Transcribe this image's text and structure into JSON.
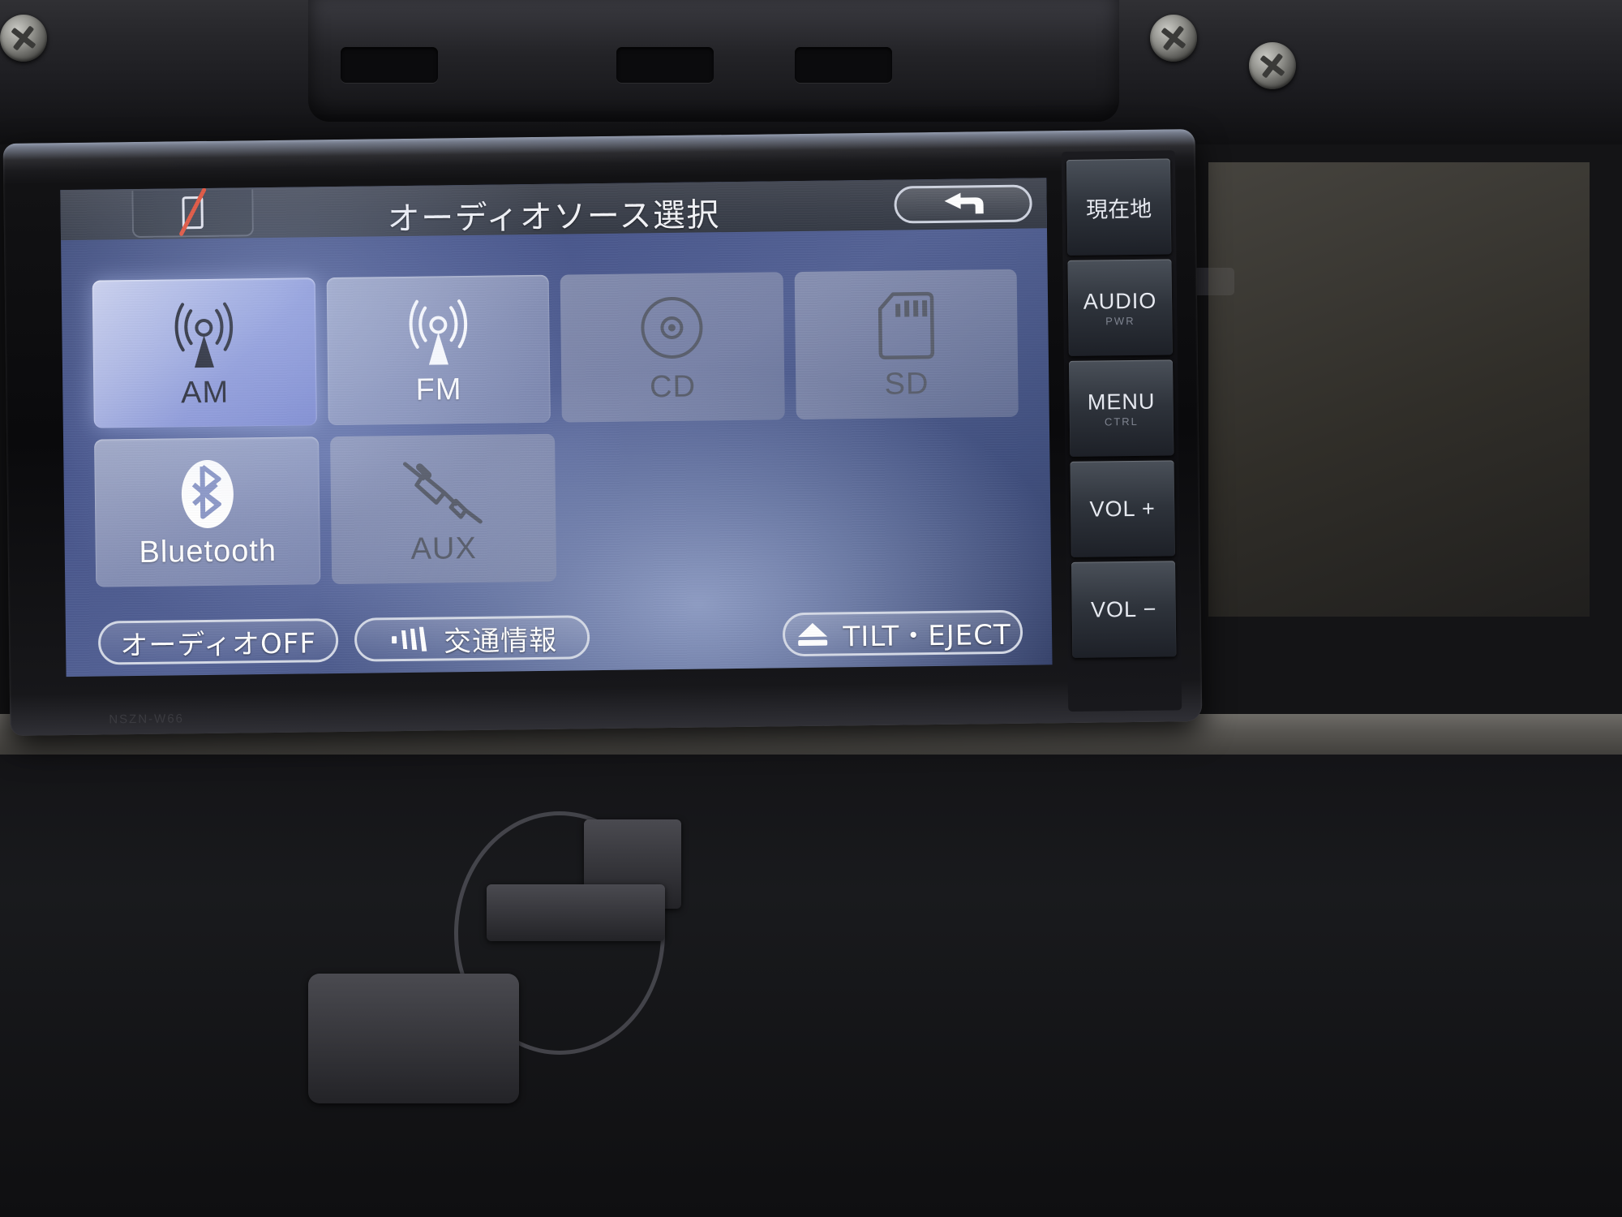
{
  "screen": {
    "title": "オーディオソース選択",
    "status_icon": "phone-disabled-icon",
    "back_button": {
      "name": "back-arrow-icon",
      "label": "↰"
    }
  },
  "sources": {
    "rows": [
      [
        {
          "id": "am",
          "label": "AM",
          "icon": "radio-antenna-icon",
          "state": "active"
        },
        {
          "id": "fm",
          "label": "FM",
          "icon": "radio-antenna-icon",
          "state": "normal"
        },
        {
          "id": "cd",
          "label": "CD",
          "icon": "compact-disc-icon",
          "state": "disabled"
        },
        {
          "id": "sd",
          "label": "SD",
          "icon": "sd-card-icon",
          "state": "disabled"
        }
      ],
      [
        {
          "id": "bluetooth",
          "label": "Bluetooth",
          "icon": "bluetooth-icon",
          "state": "normal"
        },
        {
          "id": "aux",
          "label": "AUX",
          "icon": "aux-plug-icon",
          "state": "disabled"
        }
      ]
    ]
  },
  "bottom_bar": {
    "audio_off": {
      "label": "オーディオOFF"
    },
    "traffic": {
      "label": "交通情報",
      "icon": "signal-waves-icon"
    },
    "tilt_eject": {
      "label": "TILT・EJECT",
      "icon": "eject-icon"
    }
  },
  "hardware_buttons": [
    {
      "id": "current-location",
      "main": "現在地",
      "sub": "",
      "type": "jp"
    },
    {
      "id": "audio",
      "main": "AUDIO",
      "sub": "PWR",
      "type": "en"
    },
    {
      "id": "menu",
      "main": "MENU",
      "sub": "CTRL",
      "type": "en"
    },
    {
      "id": "volume-up",
      "main": "VOL +",
      "sub": "",
      "type": "en"
    },
    {
      "id": "volume-down",
      "main": "VOL −",
      "sub": "",
      "type": "en"
    }
  ],
  "unit": {
    "model_text": "NSZN-W66"
  },
  "colors": {
    "screen_blue": "#4a5889",
    "tile_active": "#b0b9e4",
    "accent_red": "#e8492b",
    "text_white": "#f2f3f7"
  }
}
